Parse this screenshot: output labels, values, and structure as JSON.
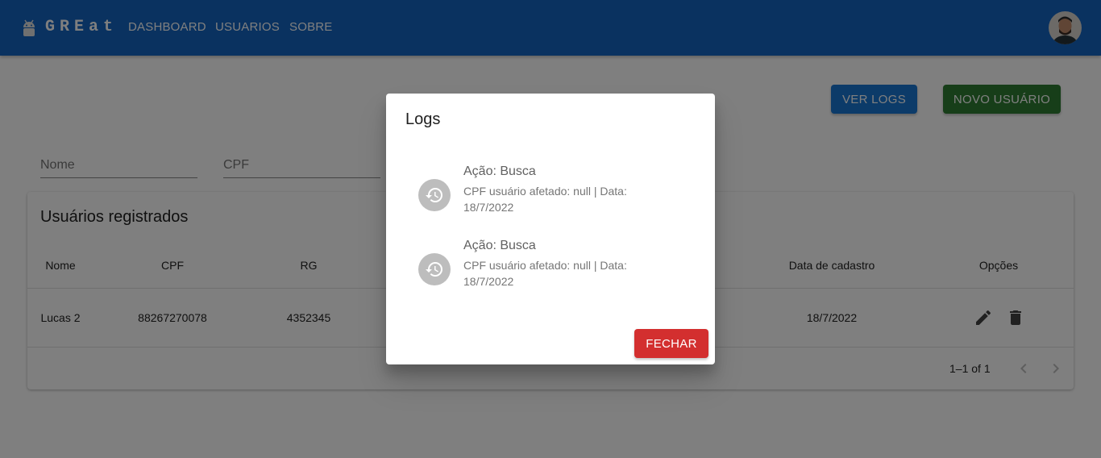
{
  "appbar": {
    "brand": "GREat",
    "logo_icon": "android-icon",
    "nav": [
      "DASHBOARD",
      "USUARIOS",
      "SOBRE"
    ],
    "avatar": "user-avatar",
    "background": "#1565c0"
  },
  "toolbar": {
    "logs_label": "VER LOGS",
    "new_user_label": "NOVO USUÁRIO",
    "logs_color": "#1976d2",
    "new_user_color": "#2e7d32"
  },
  "filters": {
    "name_placeholder": "Nome",
    "cpf_placeholder": "CPF"
  },
  "table": {
    "title": "Usuários registrados",
    "headers": [
      "Nome",
      "CPF",
      "RG",
      "Data de cadastro",
      "Opções"
    ],
    "rows": [
      {
        "name": "Lucas 2",
        "cpf": "88267270078",
        "rg": "4352345",
        "date": "18/7/2022",
        "actions": [
          "edit-icon",
          "delete-icon"
        ]
      }
    ],
    "pagination": {
      "range": "1–1 of 1",
      "prev_icon": "chevron-left-icon",
      "next_icon": "chevron-right-icon"
    }
  },
  "dialog": {
    "title": "Logs",
    "items": [
      {
        "icon": "history-icon",
        "primary": "Ação: Busca",
        "secondary": "CPF usuário afetado: null | Data: 18/7/2022"
      },
      {
        "icon": "history-icon",
        "primary": "Ação: Busca",
        "secondary": "CPF usuário afetado: null | Data: 18/7/2022"
      }
    ],
    "close_label": "FECHAR",
    "close_color": "#d32f2f"
  }
}
